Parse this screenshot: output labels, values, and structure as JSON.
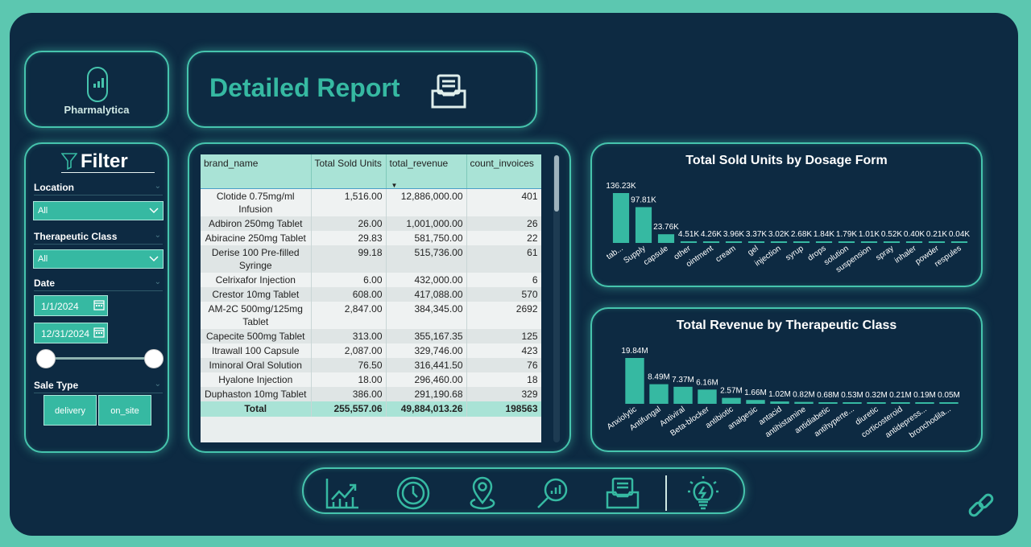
{
  "app": {
    "logo_text": "Pharmalytica",
    "title": "Detailed Report"
  },
  "filter": {
    "heading": "Filter",
    "location": {
      "label": "Location",
      "value": "All"
    },
    "therapeutic_class": {
      "label": "Therapeutic Class",
      "value": "All"
    },
    "date": {
      "label": "Date",
      "start": "1/1/2024",
      "end": "12/31/2024"
    },
    "sale_type": {
      "label": "Sale Type",
      "options": [
        "delivery",
        "on_site"
      ]
    }
  },
  "table": {
    "columns": [
      "brand_name",
      "Total Sold Units",
      "total_revenue",
      "count_invoices"
    ],
    "rows": [
      [
        "Clotide 0.75mg/ml Infusion",
        "1,516.00",
        "12,886,000.00",
        "401"
      ],
      [
        "Adbiron 250mg Tablet",
        "26.00",
        "1,001,000.00",
        "26"
      ],
      [
        "Abiracine 250mg Tablet",
        "29.83",
        "581,750.00",
        "22"
      ],
      [
        "Derise 100 Pre-filled Syringe",
        "99.18",
        "515,736.00",
        "61"
      ],
      [
        "Celrixafor Injection",
        "6.00",
        "432,000.00",
        "6"
      ],
      [
        "Crestor 10mg Tablet",
        "608.00",
        "417,088.00",
        "570"
      ],
      [
        "AM-2C 500mg/125mg Tablet",
        "2,847.00",
        "384,345.00",
        "2692"
      ],
      [
        "Capecite 500mg Tablet",
        "313.00",
        "355,167.35",
        "125"
      ],
      [
        "Itrawall 100 Capsule",
        "2,087.00",
        "329,746.00",
        "423"
      ],
      [
        "Iminoral Oral Solution",
        "76.50",
        "316,441.50",
        "76"
      ],
      [
        "Hyalone Injection",
        "18.00",
        "296,460.00",
        "18"
      ],
      [
        "Duphaston 10mg Tablet",
        "386.00",
        "291,190.68",
        "329"
      ]
    ],
    "total": [
      "Total",
      "255,557.06",
      "49,884,013.26",
      "198563"
    ]
  },
  "chart_data": [
    {
      "type": "bar",
      "title": "Total Sold Units by Dosage Form",
      "categories": [
        "tab...",
        "Supply",
        "capsule",
        "other",
        "ointment",
        "cream",
        "gel",
        "injection",
        "syrup",
        "drops",
        "solution",
        "suspension",
        "spray",
        "inhaler",
        "powder",
        "respules"
      ],
      "values": [
        136230,
        97810,
        23760,
        4510,
        4260,
        3960,
        3370,
        3020,
        2680,
        1840,
        1790,
        1010,
        520,
        400,
        210,
        40
      ],
      "labels": [
        "136.23K",
        "97.81K",
        "23.76K",
        "4.51K",
        "4.26K",
        "3.96K",
        "3.37K",
        "3.02K",
        "2.68K",
        "1.84K",
        "1.79K",
        "1.01K",
        "0.52K",
        "0.40K",
        "0.21K",
        "0.04K"
      ],
      "color": "#36b9a2"
    },
    {
      "type": "bar",
      "title": "Total Revenue by Therapeutic Class",
      "categories": [
        "Anxiolytic",
        "Antifungal",
        "Antiviral",
        "Beta-blocker",
        "antibiotic",
        "analgesic",
        "antacid",
        "antihistamine",
        "antidiabetic",
        "antihyperte...",
        "diuretic",
        "corticosteroid",
        "antidepress...",
        "bronchodila..."
      ],
      "values": [
        19.84,
        8.49,
        7.37,
        6.16,
        2.57,
        1.66,
        1.02,
        0.82,
        0.68,
        0.53,
        0.32,
        0.21,
        0.19,
        0.05
      ],
      "labels": [
        "19.84M",
        "8.49M",
        "7.37M",
        "6.16M",
        "2.57M",
        "1.66M",
        "1.02M",
        "0.82M",
        "0.68M",
        "0.53M",
        "0.32M",
        "0.21M",
        "0.19M",
        "0.05M"
      ],
      "color": "#36b9a2"
    }
  ],
  "nav": {
    "icons": [
      "growth-chart-icon",
      "clock-icon",
      "location-pin-icon",
      "search-analytics-icon",
      "report-folder-icon",
      "lightbulb-icon"
    ]
  },
  "colors": {
    "accent": "#36b9a2",
    "background": "#0d2a42",
    "outer": "#5cc7b0"
  }
}
